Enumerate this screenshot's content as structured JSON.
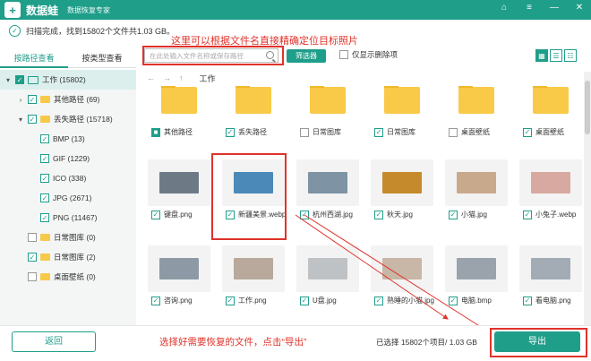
{
  "app": {
    "brand": "数据蛙",
    "subtitle": "数据恢复专家",
    "logo_glyph": "+",
    "window_buttons": [
      "⌂",
      "≡",
      "—",
      "✕"
    ]
  },
  "scan": {
    "status": "扫描完成，找到15802个文件共1.03 GB。"
  },
  "annotations": {
    "top": "这里可以根据文件名直接精确定位目标照片",
    "bottom": "选择好需要恢复的文件，点击“导出”"
  },
  "tabs": {
    "by_path": "按路径查看",
    "by_type": "按类型查看"
  },
  "tree": [
    {
      "label": "工作 (15802)",
      "level": 0,
      "expander": "▾",
      "check": "checked-solid",
      "icon": "drive",
      "selected": true
    },
    {
      "label": "其他路径 (69)",
      "level": 1,
      "expander": "›",
      "check": "checked",
      "icon": "folder"
    },
    {
      "label": "丢失路径 (15718)",
      "level": 1,
      "expander": "▾",
      "check": "checked",
      "icon": "folder"
    },
    {
      "label": "BMP (13)",
      "level": 2,
      "expander": "",
      "check": "checked",
      "icon": ""
    },
    {
      "label": "GIF (1229)",
      "level": 2,
      "expander": "",
      "check": "checked",
      "icon": ""
    },
    {
      "label": "ICO (338)",
      "level": 2,
      "expander": "",
      "check": "checked",
      "icon": ""
    },
    {
      "label": "JPG (2671)",
      "level": 2,
      "expander": "",
      "check": "checked",
      "icon": ""
    },
    {
      "label": "PNG (11467)",
      "level": 2,
      "expander": "",
      "check": "checked",
      "icon": ""
    },
    {
      "label": "日常图库 (0)",
      "level": 1,
      "expander": "",
      "check": "unchecked",
      "icon": "folder"
    },
    {
      "label": "日常图库 (2)",
      "level": 1,
      "expander": "",
      "check": "checked",
      "icon": "folder"
    },
    {
      "label": "桌面壁纸 (0)",
      "level": 1,
      "expander": "",
      "check": "unchecked",
      "icon": "folder"
    }
  ],
  "toolbar": {
    "search_placeholder": "在此处输入文件名称或保存路径",
    "filter_label": "筛选器",
    "show_deleted_label": "仅显示删除项",
    "views": [
      "▦",
      "☰",
      "☷"
    ]
  },
  "nav": {
    "back": "←",
    "forward": "→",
    "up": "↑",
    "path": "工作"
  },
  "grid": [
    {
      "name": "其他路径",
      "kind": "folder",
      "check": "partial"
    },
    {
      "name": "丢失路径",
      "kind": "folder",
      "check": "checked"
    },
    {
      "name": "日常图库",
      "kind": "folder",
      "check": "unchecked"
    },
    {
      "name": "日常图库",
      "kind": "folder",
      "check": "checked"
    },
    {
      "name": "桌面壁纸",
      "kind": "folder",
      "check": "unchecked"
    },
    {
      "name": "桌面壁纸",
      "kind": "folder",
      "check": "checked"
    },
    {
      "name": "键盘.png",
      "kind": "image",
      "color": "#6d7a86",
      "check": "checked"
    },
    {
      "name": "新疆美景.webp",
      "kind": "image",
      "color": "#4a89b8",
      "check": "checked"
    },
    {
      "name": "杭州西湖.jpg",
      "kind": "image",
      "color": "#7e93a3",
      "check": "checked"
    },
    {
      "name": "秋天.jpg",
      "kind": "image",
      "color": "#c58a2b",
      "check": "checked"
    },
    {
      "name": "小猫.jpg",
      "kind": "image",
      "color": "#c9a98b",
      "check": "checked"
    },
    {
      "name": "小兔子.webp",
      "kind": "image",
      "color": "#d8a9a0",
      "check": "checked"
    },
    {
      "name": "咨询.png",
      "kind": "image",
      "color": "#8d9aa5",
      "check": "checked"
    },
    {
      "name": "工作.png",
      "kind": "image",
      "color": "#b8a99c",
      "check": "checked"
    },
    {
      "name": "U盘.jpg",
      "kind": "image",
      "color": "#bfc2c5",
      "check": "checked"
    },
    {
      "name": "熟睡的小猫.jpg",
      "kind": "image",
      "color": "#c8b6a6",
      "check": "checked"
    },
    {
      "name": "电脑.bmp",
      "kind": "image",
      "color": "#9aa3ac",
      "check": "checked"
    },
    {
      "name": "看电脑.png",
      "kind": "image",
      "color": "#a3acb4",
      "check": "checked"
    }
  ],
  "footer": {
    "back_label": "返回",
    "selected_info": "已选择 15802个项目/ 1.03 GB",
    "export_label": "导出"
  }
}
